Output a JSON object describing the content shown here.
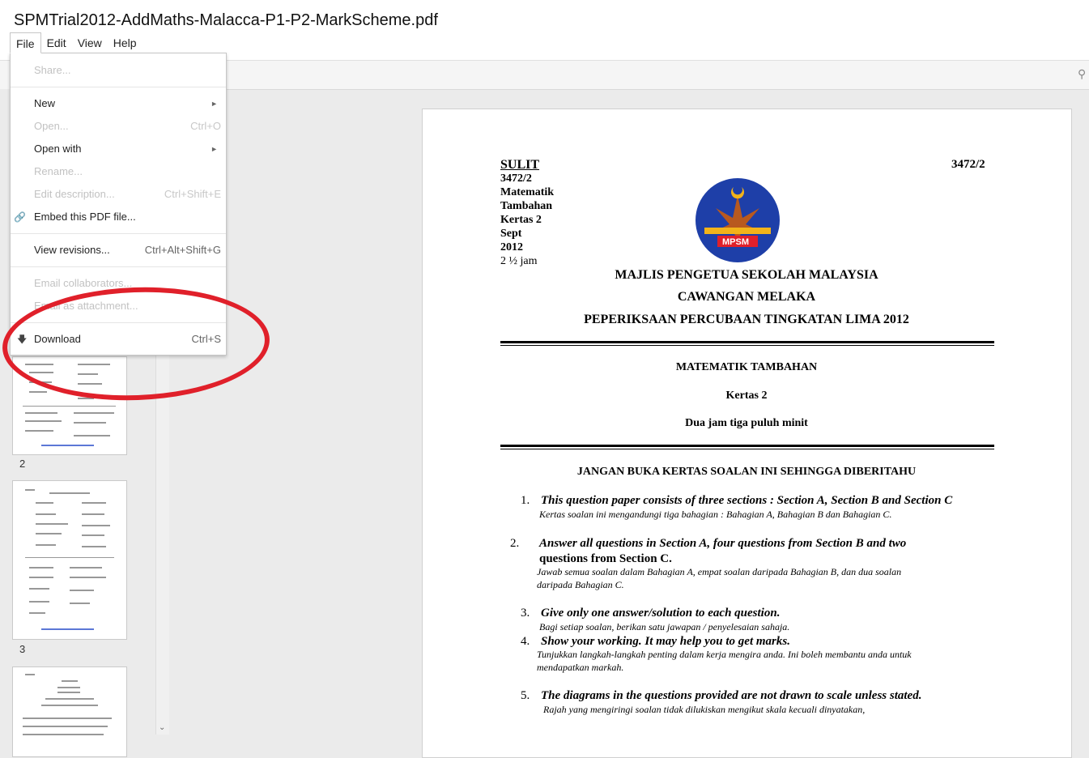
{
  "window": {
    "title": "SPMTrial2012-AddMaths-Malacca-P1-P2-MarkScheme.pdf"
  },
  "menubar": [
    "File",
    "Edit",
    "View",
    "Help"
  ],
  "file_menu": {
    "share": "Share...",
    "new": "New",
    "open": "Open...",
    "open_shortcut": "Ctrl+O",
    "open_with": "Open with",
    "rename": "Rename...",
    "edit_description": "Edit description...",
    "edit_description_shortcut": "Ctrl+Shift+E",
    "embed": "Embed this PDF file...",
    "view_revisions": "View revisions...",
    "view_revisions_shortcut": "Ctrl+Alt+Shift+G",
    "email_collaborators": "Email collaborators...",
    "email_attachment": "Email as attachment...",
    "download": "Download",
    "download_shortcut": "Ctrl+S"
  },
  "thumbnails": {
    "page2_label": "2",
    "page3_label": "3"
  },
  "document": {
    "sulit": "SULIT",
    "code_right": "3472/2",
    "code_left": "3472/2",
    "subject1": "Matematik",
    "subject2": "Tambahan",
    "paper": "Kertas 2",
    "month": "Sept",
    "year": "2012",
    "duration": "2 ½  jam",
    "logo_text": "MPSM",
    "council": "MAJLIS PENGETUA SEKOLAH MALAYSIA",
    "branch": "CAWANGAN MELAKA",
    "exam": "PEPERIKSAAN PERCUBAAN TINGKATAN LIMA 2012",
    "subject_title": "MATEMATIK   TAMBAHAN",
    "paper_title": "Kertas  2",
    "time_title": "Dua  jam  tiga  puluh  minit",
    "warning": "JANGAN  BUKA KERTAS SOALAN INI SEHINGGA DIBERITAHU",
    "instructions": [
      {
        "num": "1.",
        "en": "This question paper consists of three sections : Section A, Section B and Section C",
        "my": "Kertas soalan ini mengandungi tiga bahagian : Bahagian A, Bahagian B dan    Bahagian C."
      },
      {
        "num": "2.",
        "en1": "Answer  all  questions  in  Section  A,  four  questions  from  Section  B  and  two",
        "en2": "questions  from Section C.",
        "my1": "Jawab semua soalan dalam Bahagian A, empat soalan daripada Bahagian B, dan  dua soalan",
        "my2": "daripada Bahagian C."
      },
      {
        "num": "3.",
        "en": "Give only  one answer/solution to each question.",
        "my": "Bagi setiap soalan, berikan satu jawapan / penyelesaian sahaja."
      },
      {
        "num": "4.",
        "en": "Show your working.  It may help you to get marks.",
        "my1": "Tunjukkan langkah-langkah penting dalam kerja mengira anda. Ini boleh membantu anda untuk",
        "my2": "mendapatkan markah."
      },
      {
        "num": "5.",
        "en": "The diagrams in the questions provided are not drawn to scale unless stated.",
        "my": "Rajah yang mengiringi soalan tidak dilukiskan mengikut skala kecuali dinyatakan,"
      }
    ]
  },
  "colors": {
    "highlight_circle": "#e0202a",
    "logo_blue": "#1e3fa8",
    "logo_gold": "#f2b31a"
  }
}
